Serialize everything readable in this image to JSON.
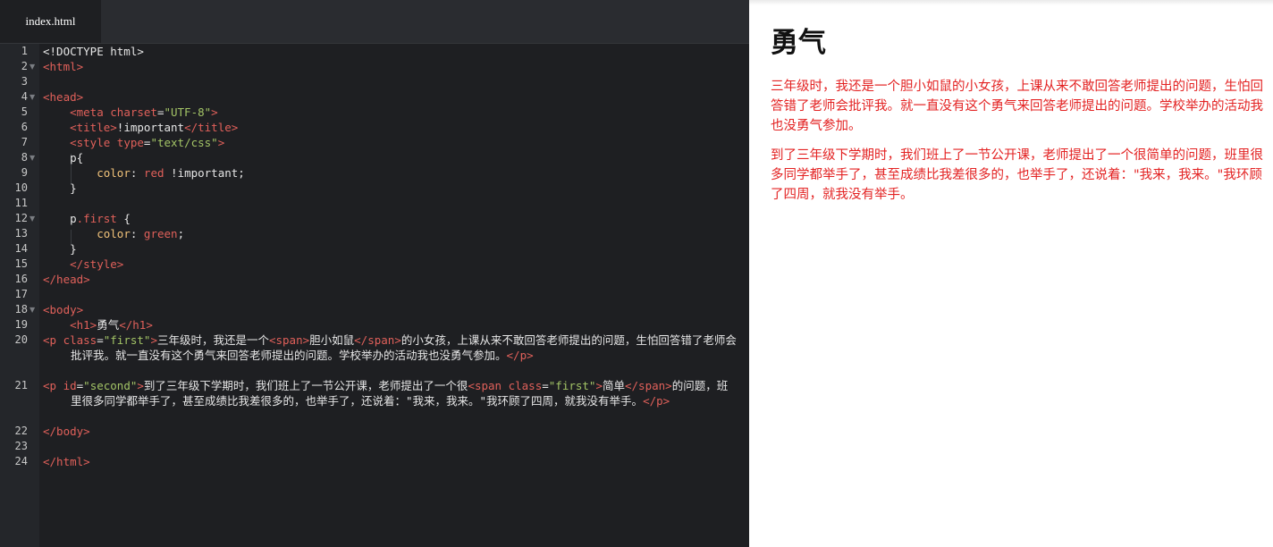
{
  "editor": {
    "tab": "index.html",
    "line_numbers": [
      "1",
      "2",
      "3",
      "4",
      "5",
      "6",
      "7",
      "8",
      "9",
      "10",
      "11",
      "12",
      "13",
      "14",
      "15",
      "16",
      "17",
      "18",
      "19",
      "20",
      "21",
      "22",
      "23",
      "24"
    ],
    "lines": {
      "l1": "<!DOCTYPE html>",
      "l2_tag": "<html>",
      "l4_tag": "<head>",
      "l5_open": "<meta ",
      "l5_attr": "charset",
      "l5_eq": "=",
      "l5_val": "\"UTF-8\"",
      "l5_close": ">",
      "l6_open": "<title>",
      "l6_text": "!important",
      "l6_close": "</title>",
      "l7_open": "<style ",
      "l7_attr": "type",
      "l7_eq": "=",
      "l7_val": "\"text/css\"",
      "l7_close": ">",
      "l8": "p{",
      "l9_prop": "color",
      "l9_colon": ": ",
      "l9_val": "red",
      "l9_rest": " !important;",
      "l10": "}",
      "l12_sel": "p",
      "l12_cls": ".first",
      "l12_brace": " {",
      "l13_prop": "color",
      "l13_colon": ": ",
      "l13_val": "green",
      "l13_semi": ";",
      "l14": "}",
      "l15": "</style>",
      "l16": "</head>",
      "l18": "<body>",
      "l19_open": "<h1>",
      "l19_text": "勇气",
      "l19_close": "</h1>",
      "l20_open": "<p ",
      "l20_attr": "class",
      "l20_eq": "=",
      "l20_val": "\"first\"",
      "l20_gt": ">",
      "l20_t1": "三年级时，我还是一个",
      "l20_span": "<span>",
      "l20_t2": "胆小如鼠",
      "l20_espan1": "</span",
      "l20_espan2": ">",
      "l20_t3": "的小女孩，上课从来不敢回答老师提出的问题，生怕回答错了老师会批评我。就一直没有这个勇气来回答老师提出的问题。学校举办的活动我也没勇气参加。",
      "l20_ep": "</p>",
      "l21_open": "<p ",
      "l21_attr": "id",
      "l21_eq": "=",
      "l21_val": "\"second\"",
      "l21_gt": ">",
      "l21_t1": "到了三年级下学期时，我们班上了一节公开课，老师提出了一个很",
      "l21_span": "<span ",
      "l21_sattr": "class",
      "l21_seq": "=",
      "l21_sval": "\"first\"",
      "l21_sgt": ">",
      "l21_t2": "简单",
      "l21_espan": "</span>",
      "l21_t3": "的问题，班里很多同学都举手了，甚至成绩比我差很多的，也举手了，还说着：\"我来，我来。\"我环顾了四周，就我没有举手。",
      "l21_ep": "</p>",
      "l22": "</body>",
      "l24": "</html>"
    }
  },
  "preview": {
    "heading": "勇气",
    "p1": "三年级时，我还是一个胆小如鼠的小女孩，上课从来不敢回答老师提出的问题，生怕回答错了老师会批评我。就一直没有这个勇气来回答老师提出的问题。学校举办的活动我也没勇气参加。",
    "p2": "到了三年级下学期时，我们班上了一节公开课，老师提出了一个很简单的问题，班里很多同学都举手了，甚至成绩比我差很多的，也举手了，还说着：\"我来，我来。\"我环顾了四周，就我没有举手。"
  },
  "colors": {
    "editor_bg": "#1e1f22",
    "tag": "#e0605a",
    "string": "#a3c466",
    "property": "#f2c37a",
    "preview_text": "#e32222"
  }
}
